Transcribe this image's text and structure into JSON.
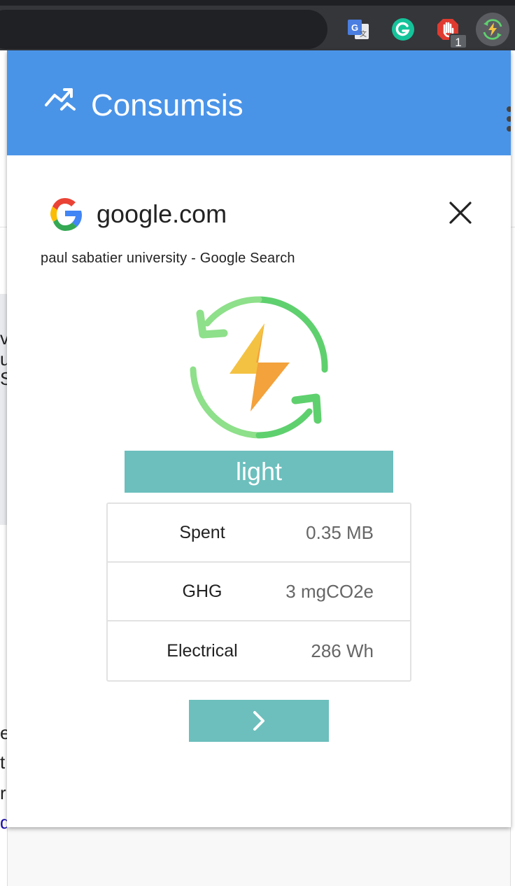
{
  "browser": {
    "extensions": [
      {
        "name": "google-translate",
        "icon": "translate-icon"
      },
      {
        "name": "grammarly",
        "icon": "grammarly-icon"
      },
      {
        "name": "adblock",
        "icon": "adblock-hand-icon",
        "badge": "1"
      },
      {
        "name": "consumsis",
        "icon": "energy-recycle-icon"
      }
    ]
  },
  "background": {
    "fragments": [
      "ve",
      "u",
      "S",
      "e",
      "t",
      "r",
      "d"
    ]
  },
  "popup": {
    "app_title": "Consumsis",
    "header_icon": "trend-chart-icon",
    "site": {
      "favicon": "google-g-icon",
      "domain": "google.com",
      "page_title": "paul sabatier university - Google Search"
    },
    "level": "light",
    "stats": [
      {
        "label": "Spent",
        "value": "0.35 MB"
      },
      {
        "label": "GHG",
        "value": "3 mgCO2e"
      },
      {
        "label": "Electrical",
        "value": "286 Wh"
      }
    ],
    "next_icon": "chevron-right-icon",
    "close_icon": "close-icon"
  },
  "colors": {
    "header": "#4a94e8",
    "accent_teal": "#6cbfbd",
    "ring_green": "#5fd06e",
    "bolt_yellow": "#f4c242",
    "bolt_orange": "#f3a23c"
  }
}
